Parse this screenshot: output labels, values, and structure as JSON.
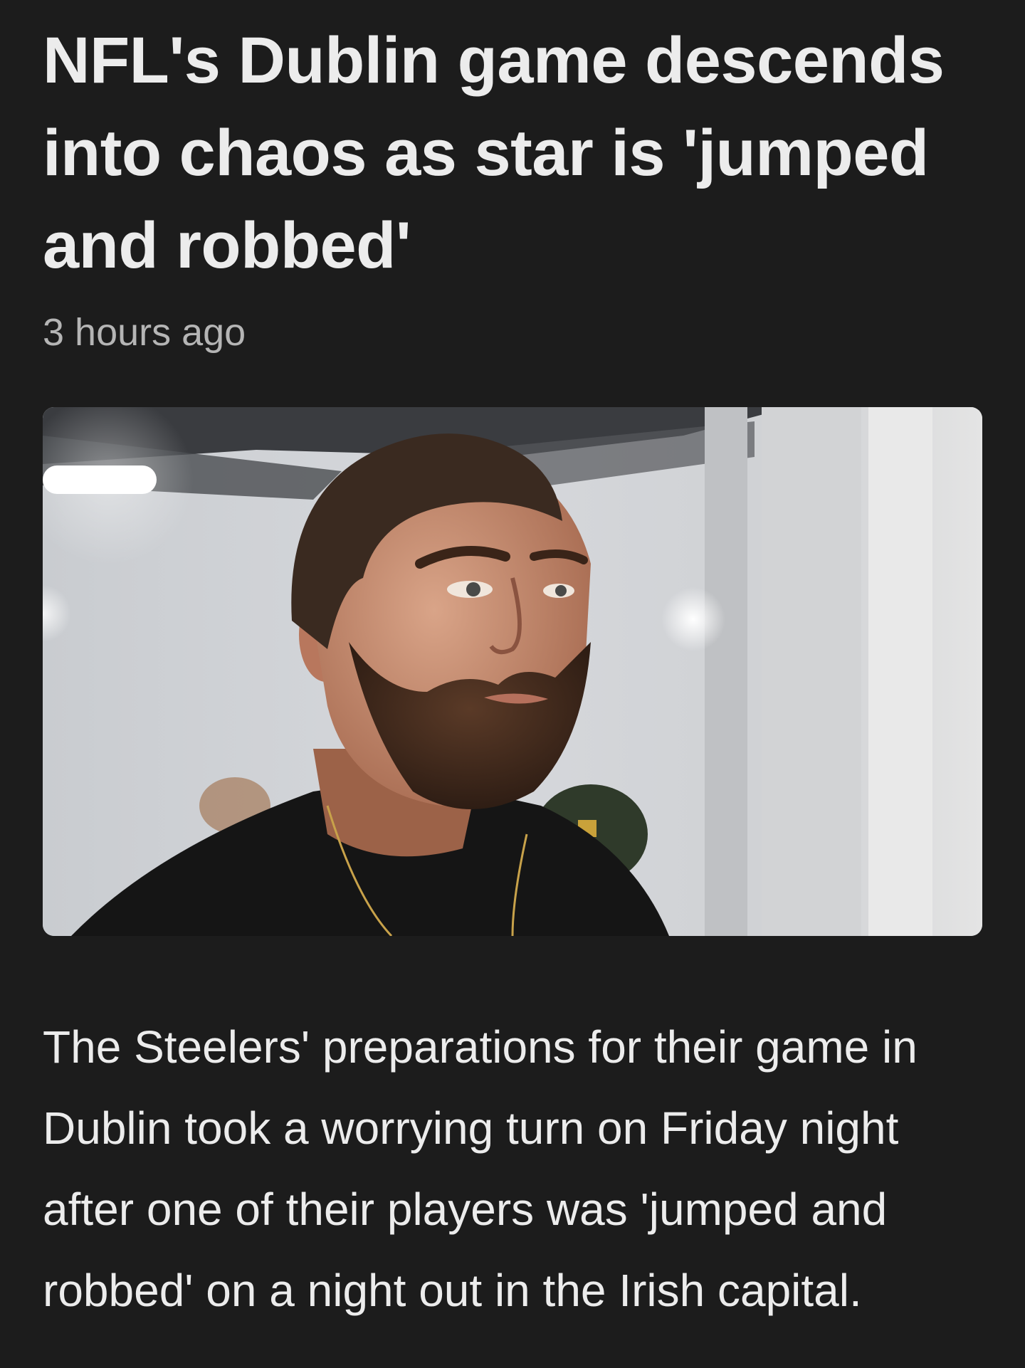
{
  "article": {
    "headline": "NFL's Dublin game descends into chaos as star is 'jumped and robbed'",
    "timestamp": "3 hours ago",
    "image_subject": "Bearded football player in black t-shirt with gold chain in a stadium tunnel",
    "body": "The Steelers' preparations for their game in Dublin took a worrying turn on Friday night after one of their players was 'jumped and robbed' on a night out in the Irish capital."
  },
  "colors": {
    "background": "#1c1c1c",
    "headline": "#ececec",
    "timestamp": "#b5b5b5",
    "body": "#ececec"
  }
}
